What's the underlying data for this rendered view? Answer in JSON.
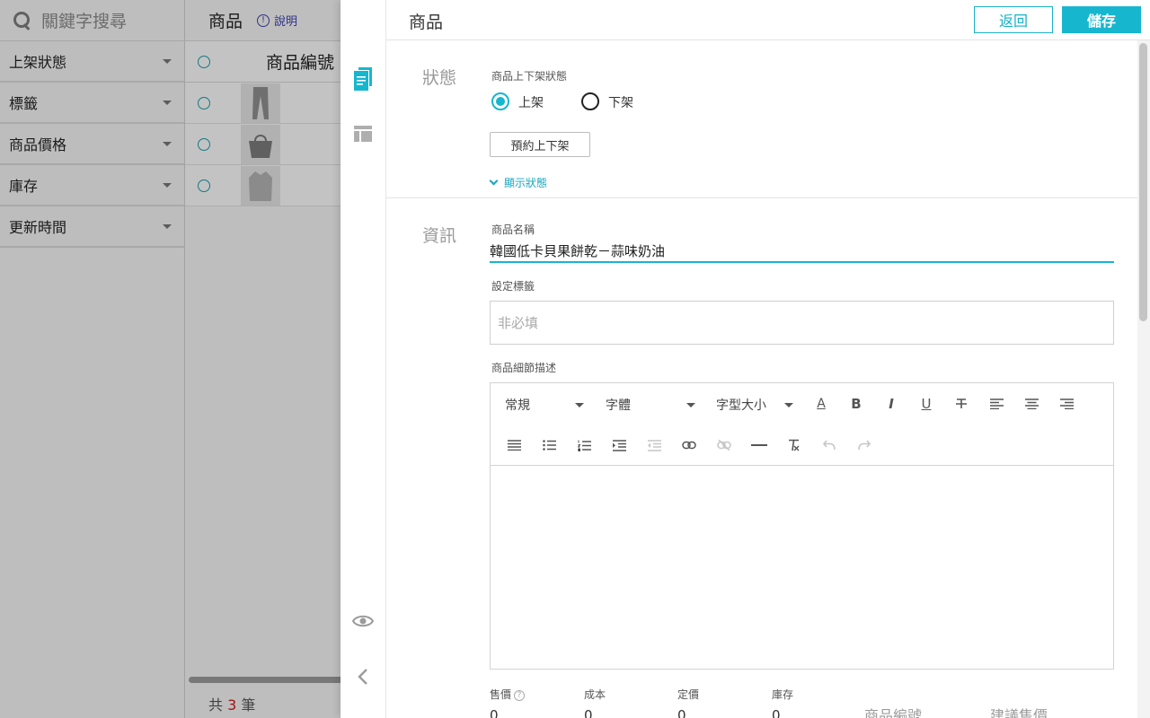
{
  "background": {
    "search_placeholder": "關鍵字搜尋",
    "filters": [
      "上架狀態",
      "標籤",
      "商品價格",
      "庫存",
      "更新時間"
    ],
    "list_title": "商品",
    "help_label": "說明",
    "column_header": "商品編號",
    "total_prefix": "共",
    "total_count": "3",
    "total_suffix": "筆"
  },
  "panel": {
    "title": "商品",
    "back_label": "返回",
    "save_label": "儲存",
    "status_section": "狀態",
    "status_field_label": "商品上下架狀態",
    "status_on_label": "上架",
    "status_off_label": "下架",
    "schedule_button": "預約上下架",
    "display_status_link": "顯示狀態",
    "info_section": "資訊",
    "name_label": "商品名稱",
    "name_value": "韓國低卡貝果餅乾－蒜味奶油",
    "tags_label": "設定標籤",
    "tags_placeholder": "非必填",
    "desc_label": "商品細節描述",
    "editor": {
      "format_select": "常規",
      "font_select": "字體",
      "size_select": "字型大小",
      "bold_glyph": "B",
      "italic_glyph": "I",
      "underline_glyph": "U",
      "text_color_glyph": "A"
    },
    "prices": {
      "sale_label": "售價",
      "cost_label": "成本",
      "list_label": "定價",
      "stock_label": "庫存",
      "sale_value": "0",
      "cost_value": "0",
      "list_value": "0",
      "stock_value": "0",
      "sku_label": "商品編號",
      "suggested_label": "建議售價"
    }
  },
  "colors": {
    "accent": "#17b6cf",
    "help": "#3c3fb0",
    "count": "#d21a1a"
  }
}
